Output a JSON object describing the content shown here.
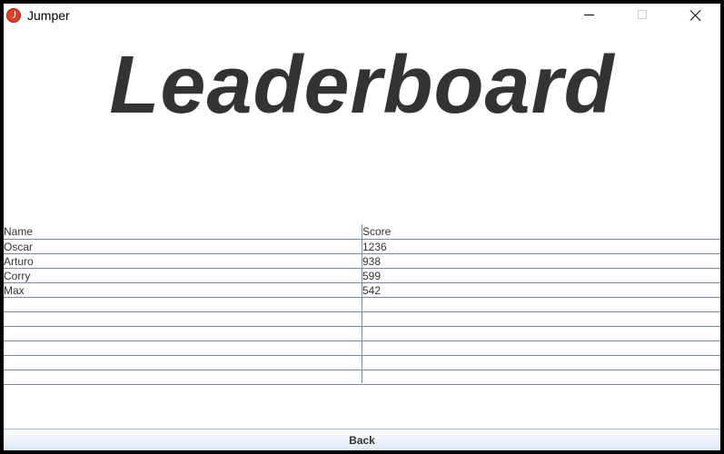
{
  "window": {
    "title": "Jumper"
  },
  "heading": "Leaderboard",
  "table": {
    "columns": [
      "Name",
      "Score"
    ],
    "rows": [
      {
        "name": "Oscar",
        "score": "1236"
      },
      {
        "name": "Arturo",
        "score": "938"
      },
      {
        "name": "Corry",
        "score": "599"
      },
      {
        "name": "Max",
        "score": "542"
      },
      {
        "name": "",
        "score": ""
      },
      {
        "name": "",
        "score": ""
      },
      {
        "name": "",
        "score": ""
      },
      {
        "name": "",
        "score": ""
      },
      {
        "name": "",
        "score": ""
      },
      {
        "name": "",
        "score": ""
      }
    ]
  },
  "footer": {
    "back_label": "Back"
  },
  "icons": {
    "app": "app-icon",
    "minimize": "minimize-icon",
    "maximize": "maximize-icon",
    "close": "close-icon"
  },
  "colors": {
    "heading": "#333333",
    "grid": "#7a8a99",
    "app_icon": "#d9412b"
  }
}
